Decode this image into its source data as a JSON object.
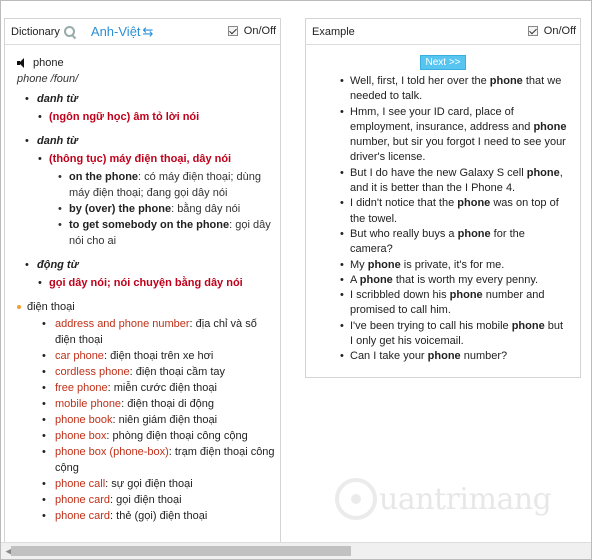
{
  "dictionary": {
    "title": "Dictionary",
    "lang": "Anh-Việt",
    "toggle_label": "On/Off",
    "word": "phone",
    "pron": "phone /foun/",
    "entries": [
      {
        "pos": "danh từ",
        "meanings": [
          {
            "text": "(ngôn ngữ học) âm tỏ lời nói"
          }
        ]
      },
      {
        "pos": "danh từ",
        "meanings": [
          {
            "text": "(thông tục) máy điện thoại, dây nói"
          }
        ],
        "phrases": [
          {
            "phrase": "on the phone",
            "sep": ": ",
            "def": "có máy điện thoại; dùng máy điện thoại; đang gọi dây nói"
          },
          {
            "phrase": "by (over) the phone",
            "sep": ": ",
            "def": "bằng dây nói"
          },
          {
            "phrase": "to get somebody on the phone",
            "sep": ": ",
            "def": "gọi dây nói cho ai"
          }
        ]
      },
      {
        "pos": "động từ",
        "meanings": [
          {
            "text": "gọi dây nói; nói chuyện bằng dây nói"
          }
        ]
      }
    ],
    "vn_heading": "điện thoại",
    "vn_items": [
      {
        "term": "address and phone number",
        "def": "địa chỉ và số điện thoại"
      },
      {
        "term": "car phone",
        "def": "điện thoại trên xe hơi"
      },
      {
        "term": "cordless phone",
        "def": "điện thoại cầm tay"
      },
      {
        "term": "free phone",
        "def": "miễn cước điện thoại"
      },
      {
        "term": "mobile phone",
        "def": "điện thoại di động"
      },
      {
        "term": "phone book",
        "def": "niên giám điện thoại"
      },
      {
        "term": "phone box",
        "def": "phòng điện thoại công cộng"
      },
      {
        "term": "phone box (phone-box)",
        "def": "trạm điện thoại công cộng"
      },
      {
        "term": "phone call",
        "def": "sự gọi điện thoại"
      },
      {
        "term": "phone card",
        "def": "gọi điện thoại"
      },
      {
        "term": "phone card",
        "def": "thẻ (gọi) điện thoại"
      }
    ]
  },
  "example": {
    "title": "Example",
    "toggle_label": "On/Off",
    "next_label": "Next >>",
    "sentences": [
      [
        "Well, first, I told her over the ",
        "phone",
        " that we needed to talk."
      ],
      [
        "Hmm, I see your ID card, place of employment, insurance, address and ",
        "phone",
        " number, but sir you forgot I need to see your driver's license."
      ],
      [
        "But I do have the new Galaxy S cell ",
        "phone",
        ", and it is better than the I Phone 4."
      ],
      [
        "I didn't notice that the ",
        "phone",
        " was on top of the towel."
      ],
      [
        "But who really buys a ",
        "phone",
        " for the camera?"
      ],
      [
        "My ",
        "phone",
        " is private, it's for me."
      ],
      [
        "A ",
        "phone",
        " that is worth my every penny."
      ],
      [
        "I scribbled down his ",
        "phone",
        " number and promised to call him."
      ],
      [
        "I've been trying to call his mobile ",
        "phone",
        " but I only get his voicemail."
      ],
      [
        "Can I take your ",
        "phone",
        " number?"
      ]
    ]
  },
  "watermark": {
    "text": "uantrimang"
  },
  "scrollbar": {
    "left_arrow": "◀"
  }
}
